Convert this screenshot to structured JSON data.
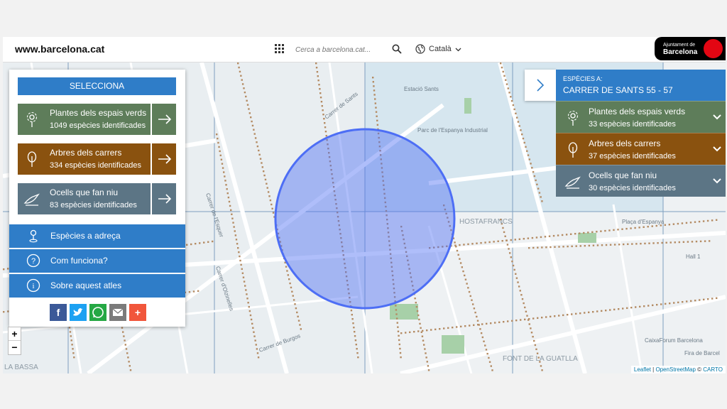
{
  "header": {
    "site_url": "www.barcelona.cat",
    "search_placeholder": "Cerca a barcelona.cat...",
    "language": "Català",
    "logo_line1": "Ajuntament de",
    "logo_line2": "Barcelona"
  },
  "map": {
    "street_labels": [
      "Carrer de Sants",
      "Estació Sants",
      "Parc de l'Espanya Industrial",
      "Carrer de Burgos",
      "Carrer d'Olzinelles",
      "Carrer de l'Esquer",
      "Plaça d'Espanya",
      "Hall 1",
      "Fira de Barcel",
      "CaixaForum Barcelona",
      "HOSTAFRANCS",
      "LA BASSA",
      "FONT DE LA GUATLLA"
    ],
    "selection_circle_color": "#4d6ef5"
  },
  "left_panel": {
    "select_label": "SELECCIONA",
    "categories": [
      {
        "name": "Plantes dels espais verds",
        "count": "1049 espècies identificades",
        "icon": "flower-icon",
        "color": "#5e7d5a"
      },
      {
        "name": "Arbres dels carrers",
        "count": "334 espècies identificades",
        "icon": "tree-icon",
        "color": "#8a520f"
      },
      {
        "name": "Ocells que fan niu",
        "count": "83 espècies identificades",
        "icon": "bird-icon",
        "color": "#5c7585"
      }
    ],
    "menu": [
      {
        "label": "Espècies a adreça",
        "icon": "location-pin-icon"
      },
      {
        "label": "Com funciona?",
        "icon": "question-icon"
      },
      {
        "label": "Sobre aquest atles",
        "icon": "info-icon"
      }
    ],
    "share": [
      "facebook-icon",
      "twitter-icon",
      "whatsapp-icon",
      "email-icon",
      "plus-share-icon"
    ]
  },
  "zoom": {
    "in": "+",
    "out": "−"
  },
  "right_panel": {
    "title_small": "ESPÈCIES A:",
    "title_address": "CARRER DE SANTS 55 - 57",
    "categories": [
      {
        "name": "Plantes dels espais verds",
        "count": "33 espècies identificades"
      },
      {
        "name": "Arbres dels carrers",
        "count": "37 espècies identificades"
      },
      {
        "name": "Ocells que fan niu",
        "count": "30 espècies identificades"
      }
    ]
  },
  "attribution": {
    "leaflet": "Leaflet",
    "osm": "OpenStreetMap",
    "copy": "© ",
    "carto": "CARTO",
    "sep": " | "
  }
}
